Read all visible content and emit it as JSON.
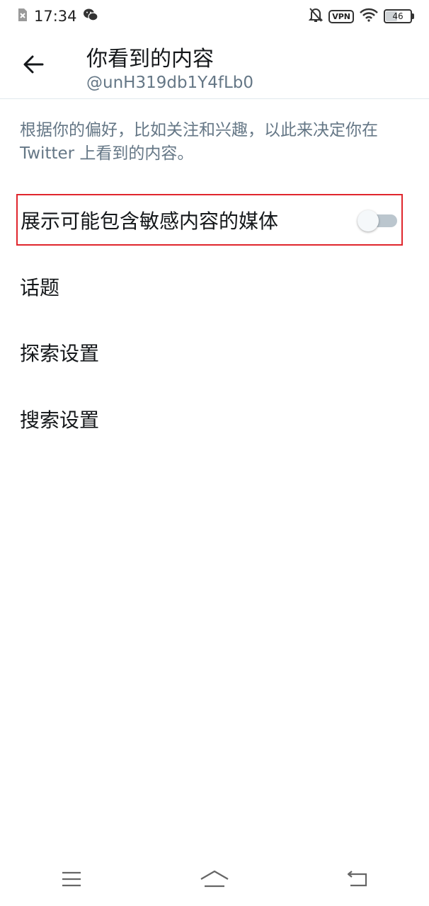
{
  "status_bar": {
    "time": "17:34",
    "vpn": "VPN",
    "battery": "46",
    "icons": [
      "sim-error-icon",
      "wechat-icon",
      "mute-bell-icon",
      "vpn-icon",
      "wifi-icon",
      "battery-icon"
    ]
  },
  "header": {
    "title": "你看到的内容",
    "subtitle": "@unH319db1Y4fLb0",
    "back_icon": "back-arrow-icon"
  },
  "description": "根据你的偏好，比如关注和兴趣，以此来决定你在 Twitter 上看到的内容。",
  "settings": {
    "sensitive_media": {
      "label": "展示可能包含敏感内容的媒体",
      "enabled": false
    },
    "topics": {
      "label": "话题"
    },
    "explore": {
      "label": "探索设置"
    },
    "search": {
      "label": "搜索设置"
    }
  },
  "nav_bar": {
    "icons": [
      "menu-icon",
      "home-icon",
      "back-icon"
    ]
  },
  "colors": {
    "text_primary": "#14171a",
    "text_secondary": "#657786",
    "highlight_border": "#e0262d",
    "divider": "#e1e8ed"
  }
}
